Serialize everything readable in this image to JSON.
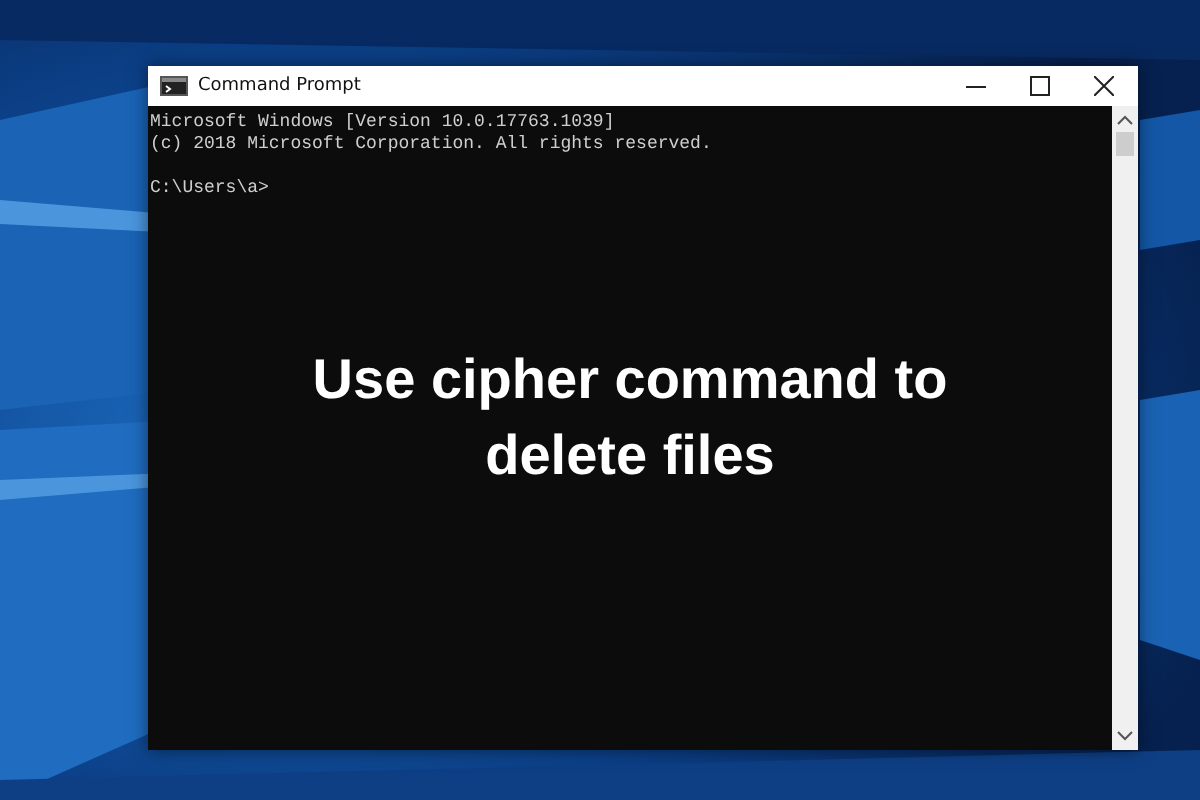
{
  "window": {
    "title": "Command Prompt",
    "output": [
      "Microsoft Windows [Version 10.0.17763.1039]",
      "(c) 2018 Microsoft Corporation. All rights reserved."
    ],
    "prompt": "C:\\Users\\a>"
  },
  "caption": "Use cipher command to delete files"
}
